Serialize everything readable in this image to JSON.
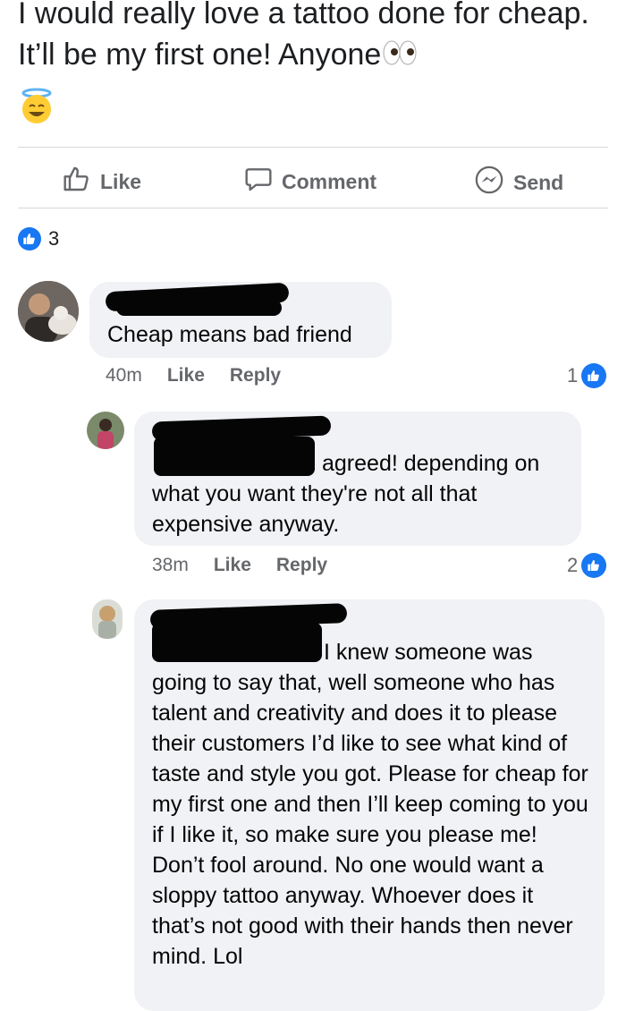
{
  "post": {
    "text": "I would really love a tattoo done for cheap. It’ll be my first one! Anyone",
    "emoji_eyes": "eyes-emoji",
    "emoji_halo": "smiling-halo-emoji"
  },
  "actions": {
    "like": "Like",
    "comment": "Comment",
    "send": "Send"
  },
  "reactions": {
    "count": "3",
    "icon": "like-badge-icon"
  },
  "comments": [
    {
      "text": "Cheap means bad friend",
      "time": "40m",
      "like": "Like",
      "reply": "Reply",
      "reaction_count": "1"
    },
    {
      "text": "agreed! depending on",
      "text_rest": "what you want they're not all that expensive anyway.",
      "time": "38m",
      "like": "Like",
      "reply": "Reply",
      "reaction_count": "2"
    },
    {
      "text": "I knew someone was",
      "text_rest": "going to say that, well someone who has talent and creativity and does it to please their customers I’d like to see what kind of taste and style you got. Please for cheap for my first one and then I’ll keep coming to you if I like it, so make sure you please me! Don’t fool around. No one would want a sloppy tattoo anyway. Whoever does it that’s not good with their hands then never mind. Lol"
    }
  ],
  "colors": {
    "accent": "#1877f2",
    "bubble": "#f0f2f5",
    "muted": "#65676b"
  }
}
